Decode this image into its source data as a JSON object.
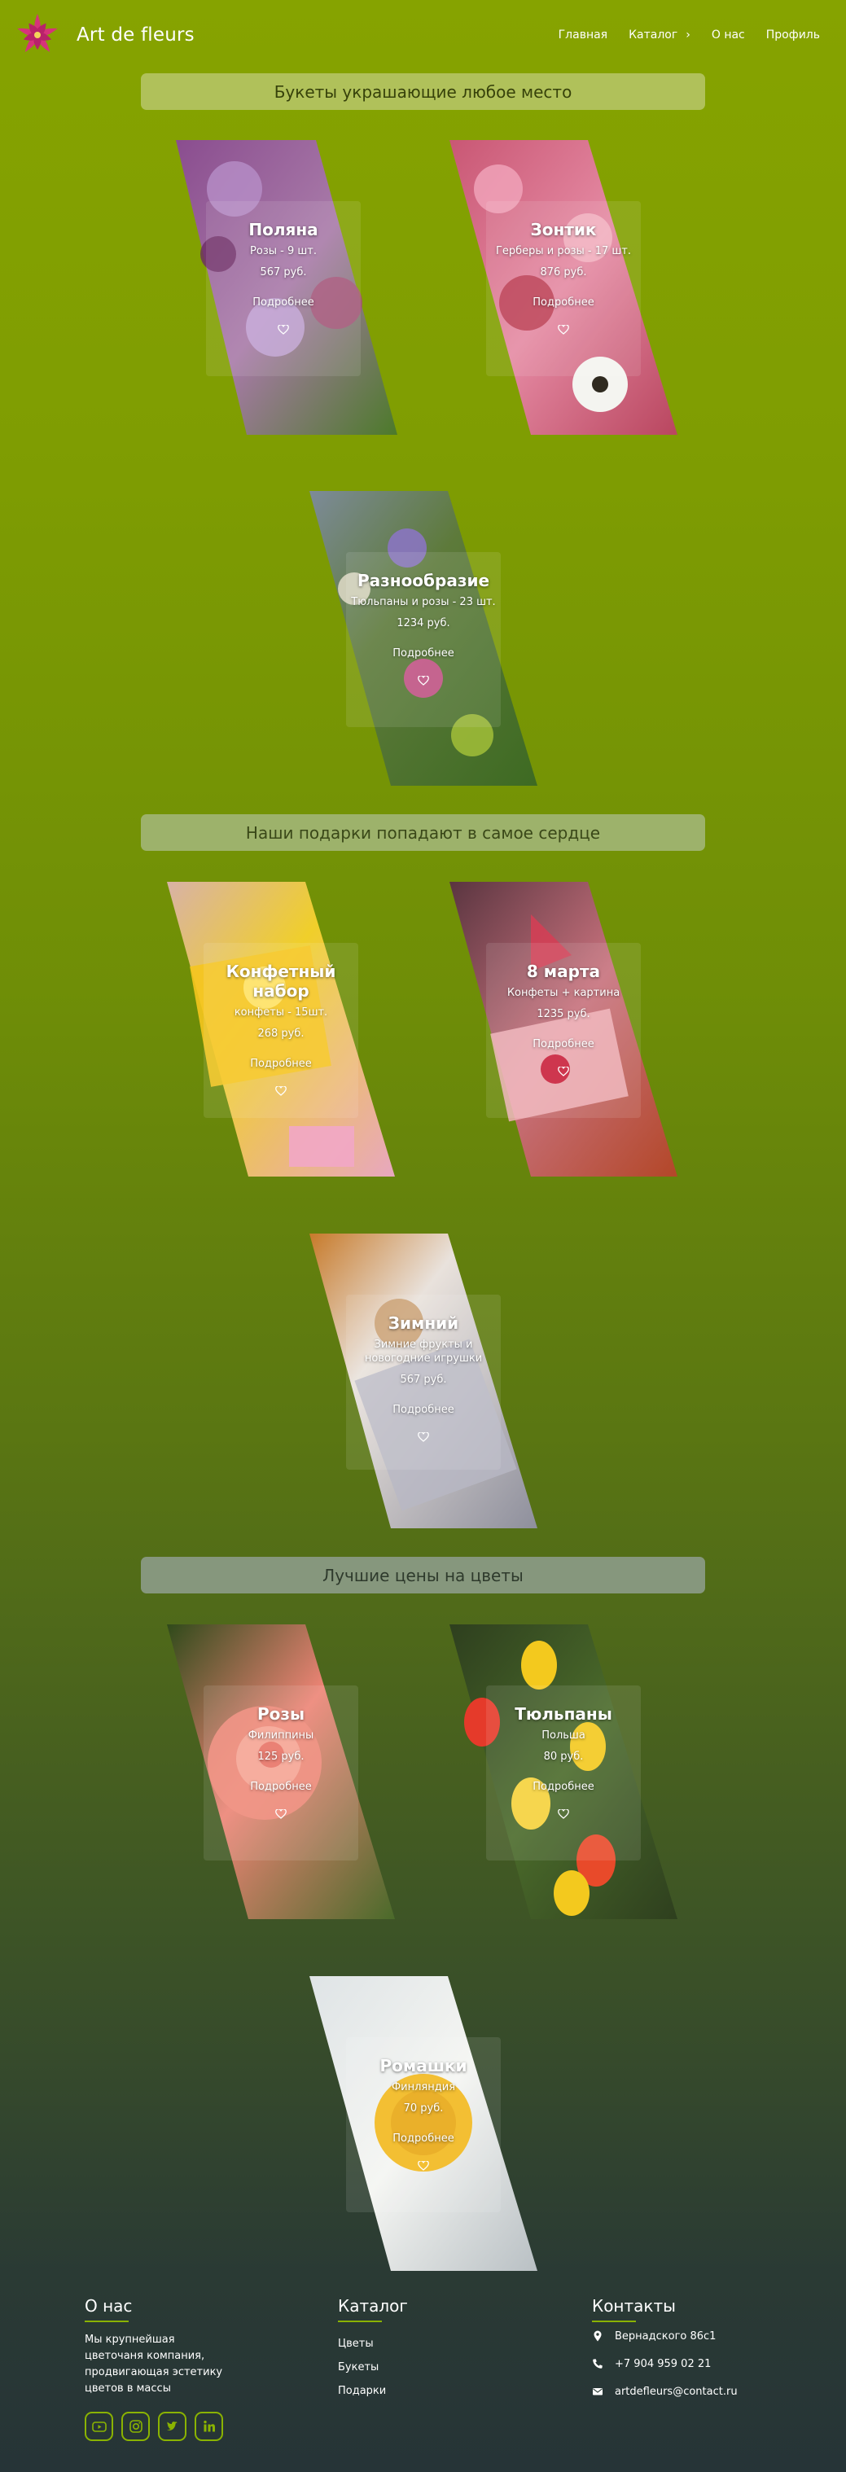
{
  "header": {
    "brand_name": "Art de fleurs",
    "nav": {
      "home": "Главная",
      "catalog": "Каталог",
      "about": "О нас",
      "profile": "Профиль"
    }
  },
  "sections": [
    {
      "title": "Букеты украшающие любое место",
      "cards": [
        {
          "title": "Поляна",
          "desc": "Розы - 9 шт.",
          "price": "567 руб.",
          "more": "Подробнее"
        },
        {
          "title": "Зонтик",
          "desc": "Герберы и розы - 17 шт.",
          "price": "876 руб.",
          "more": "Подробнее"
        },
        {
          "title": "Разнообразие",
          "desc": "Тюльпаны и розы - 23 шт.",
          "price": "1234 руб.",
          "more": "Подробнее"
        }
      ]
    },
    {
      "title": "Наши подарки попадают в самое сердце",
      "cards": [
        {
          "title": "Конфетный набор",
          "desc": "конфеты - 15шт.",
          "price": "268 руб.",
          "more": "Подробнее"
        },
        {
          "title": "8 марта",
          "desc": "Конфеты + картина",
          "price": "1235 руб.",
          "more": "Подробнее"
        },
        {
          "title": "Зимний",
          "desc": "Зимние фрукты и новогодние игрушки",
          "price": "567 руб.",
          "more": "Подробнее"
        }
      ]
    },
    {
      "title": "Лучшие цены на цветы",
      "cards": [
        {
          "title": "Розы",
          "desc": "Филиппины",
          "price": "125 руб.",
          "more": "Подробнее"
        },
        {
          "title": "Тюльпаны",
          "desc": "Польша",
          "price": "80 руб.",
          "more": "Подробнее"
        },
        {
          "title": "Ромашки",
          "desc": "Финляндия",
          "price": "70 руб.",
          "more": "Подробнее"
        }
      ]
    }
  ],
  "footer": {
    "about": {
      "title": "О нас",
      "text": "Мы крупнейшая цветочаня компания, продвигающая эстетику цветов в массы"
    },
    "catalog": {
      "title": "Каталог",
      "links": [
        "Цветы",
        "Букеты",
        "Подарки"
      ]
    },
    "contacts": {
      "title": "Контакты",
      "address": "Вернадского 86с1",
      "phone": "+7 904 959 02 21",
      "email": "artdefleurs@contact.ru"
    },
    "socials": [
      "youtube-icon",
      "instagram-icon",
      "twitter-icon",
      "linkedin-icon"
    ]
  },
  "colors": {
    "accent": "#8ab300",
    "logo": "#d6337a"
  }
}
